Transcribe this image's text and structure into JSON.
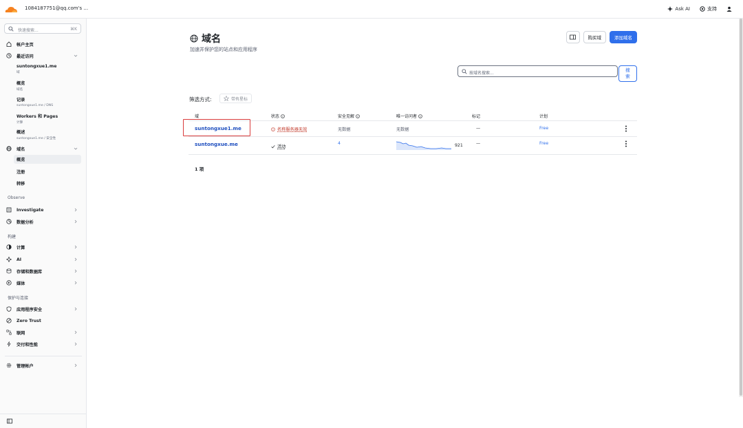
{
  "topbar": {
    "account": "1084187751@qq.com's ...",
    "ask_ai": "Ask AI",
    "support": "支持"
  },
  "sidebar": {
    "search_placeholder": "快速搜索...",
    "search_shortcut": "⌘K",
    "home": "帐户主页",
    "recent": "最近访问",
    "recent_items": [
      {
        "title": "suntongxue1.me",
        "sub": "域"
      },
      {
        "title": "概览",
        "sub": "域名"
      },
      {
        "title": "记录",
        "sub": "suntongxue1.me  /  DNS"
      },
      {
        "title": "Workers 和 Pages",
        "sub": "计算"
      },
      {
        "title": "概述",
        "sub": "suntongxue1.me  /  安全性"
      }
    ],
    "domains": "域名",
    "domain_items": [
      "概览",
      "注册",
      "转移"
    ],
    "observe_section": "Observe",
    "investigate": "Investigate",
    "analytics": "数据分析",
    "build_section": "构建",
    "compute": "计算",
    "ai": "AI",
    "storage": "存储和数据库",
    "media": "媒体",
    "protect_section": "保护与连接",
    "app_security": "应用程序安全",
    "zero_trust": "Zero Trust",
    "networking": "联网",
    "delivery": "交付和性能",
    "manage_account": "管理帐户"
  },
  "main": {
    "title": "域名",
    "subtitle": "加速并保护您的站点和应用程序",
    "buy_domain": "购买域",
    "add_domain": "添加域名",
    "search_placeholder": "按域名搜索...",
    "search_btn": "搜\n索",
    "filter_label": "筛选方式:",
    "filter_starred": "带有星标",
    "table": {
      "headers": {
        "domain": "域",
        "status": "状态",
        "security": "安全见解",
        "visitors": "唯一访问者",
        "tags": "标记",
        "plan": "计划"
      },
      "rows": [
        {
          "domain": "suntongxue1.me",
          "status": "名称服务器无效",
          "security": "无数据",
          "visitors": "无数据",
          "tags": "—",
          "plan": "Free"
        },
        {
          "domain": "suntongxue.me",
          "status": "活动",
          "security": "4",
          "visitors": "921",
          "tags": "—",
          "plan": "Free"
        }
      ]
    },
    "count": "1 项"
  },
  "colors": {
    "accent": "#2f6feb",
    "error": "#c23a2b",
    "highlight": "#d93a3a",
    "cloudflare_orange": "#f6821f"
  }
}
